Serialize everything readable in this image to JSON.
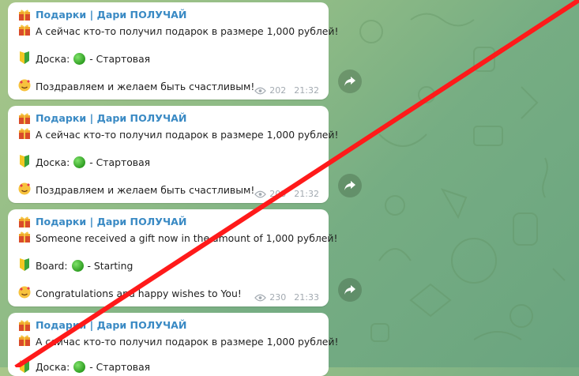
{
  "chat": {
    "messages": [
      {
        "sender": "Подарки | Дари ПОЛУЧАЙ",
        "line1": "А сейчас кто-то получил подарок в размере 1,000 рублей!",
        "board_label": "Доска:",
        "board_value": "- Стартовая",
        "congrats": "Поздравляем и желаем быть счастливым!",
        "views": "202",
        "time": "21:32"
      },
      {
        "sender": "Подарки | Дари ПОЛУЧАЙ",
        "line1": "А сейчас кто-то получил подарок в размере 1,000 рублей!",
        "board_label": "Доска:",
        "board_value": "- Стартовая",
        "congrats": "Поздравляем и желаем быть счастливым!",
        "views": "203",
        "time": "21:32"
      },
      {
        "sender": "Подарки | Дари ПОЛУЧАЙ",
        "line1": "Someone received a gift now in the amount of 1,000 рублей!",
        "board_label": "Board:",
        "board_value": "- Starting",
        "congrats": "Congratulations and happy wishes to You!",
        "views": "230",
        "time": "21:33"
      },
      {
        "sender": "Подарки | Дари ПОЛУЧАЙ",
        "line1": "А сейчас кто-то получил подарок в размере 1,000 рублей!",
        "board_label": "Доска:",
        "board_value": "- Стартовая",
        "congrats": "",
        "views": "",
        "time": ""
      }
    ]
  },
  "icons": {
    "gift": "gift-icon",
    "beginner": "beginner-badge-icon",
    "green_circle": "green-circle-icon",
    "party_face": "smiling-face-with-hearts-icon",
    "views": "eye-icon",
    "share": "share-arrow-icon"
  },
  "colors": {
    "sender": "#3a8ac4",
    "strike": "#ff1a1a",
    "bubble": "#ffffff",
    "meta": "#a3aab1"
  }
}
